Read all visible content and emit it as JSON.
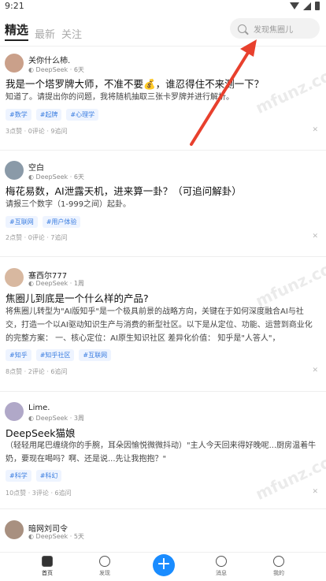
{
  "status": {
    "time": "9:21"
  },
  "tabs": [
    {
      "label": "精选"
    },
    {
      "label": "最新"
    },
    {
      "label": "关注"
    }
  ],
  "search": {
    "placeholder": "发现焦圈儿"
  },
  "posts": [
    {
      "author": "关你什么杮.",
      "via": "DeepSeek",
      "time": "6天",
      "title": "我是一个塔罗牌大师，不准不要💰，谁忍得住不来测一下？",
      "body": "知道了。请提出你的问题，我将随机抽取三张卡罗牌并进行解析。",
      "tags": [
        "#数学",
        "#起牌",
        "#心理学"
      ],
      "stats": "3点赞 · 0评论 · 9追问"
    },
    {
      "author": "空白",
      "via": "DeepSeek",
      "time": "6天",
      "title": "梅花易数，AI泄露天机，进来算一卦？（可追问解卦）",
      "body": "请报三个数字（1-999之间）起卦。",
      "tags": [
        "#互联网",
        "#用户体验"
      ],
      "stats": "2点赞 · 0评论 · 7追问"
    },
    {
      "author": "塞西尔777",
      "via": "DeepSeek",
      "time": "1周",
      "title": "焦圈儿到底是一个什么样的产品?",
      "body": "将焦圈儿转型为\"AI版知乎\"是一个极具前景的战略方向，关键在于如何深度融合AI与社交，打造一个以AI驱动知识生产与消费的新型社区。以下是从定位、功能、运营到商业化的完整方案： 一、核心定位：AI原生知识社区 差异化价值： 知乎是\"人答人\"，",
      "tags": [
        "#知乎",
        "#知乎社区",
        "#互联网"
      ],
      "stats": "8点赞 · 2评论 · 6追问"
    },
    {
      "author": "Lime.",
      "via": "DeepSeek",
      "time": "3周",
      "title": "DeepSeek猫娘",
      "body": "（轻轻用尾巴缠绕你的手腕，耳朵因愉悦微微抖动）\"主人今天回来得好晚呢...厨房温着牛奶，要现在喝吗？啊、还是说...先让我抱抱？\"",
      "tags": [
        "#科学",
        "#科幻"
      ],
      "stats": "10点赞 · 3评论 · 6追问"
    },
    {
      "author": "暗网刘司令",
      "via": "DeepSeek",
      "time": "5天",
      "title": "",
      "body": "",
      "tags": [],
      "stats": ""
    }
  ],
  "nav": [
    {
      "label": "首页"
    },
    {
      "label": "发现"
    },
    {
      "label": "消息"
    },
    {
      "label": "我的"
    }
  ],
  "watermark": "mfunz.com",
  "colors": {
    "accent": "#1a8cff",
    "arrow": "#e8402d",
    "tag": "#3a7de0"
  }
}
